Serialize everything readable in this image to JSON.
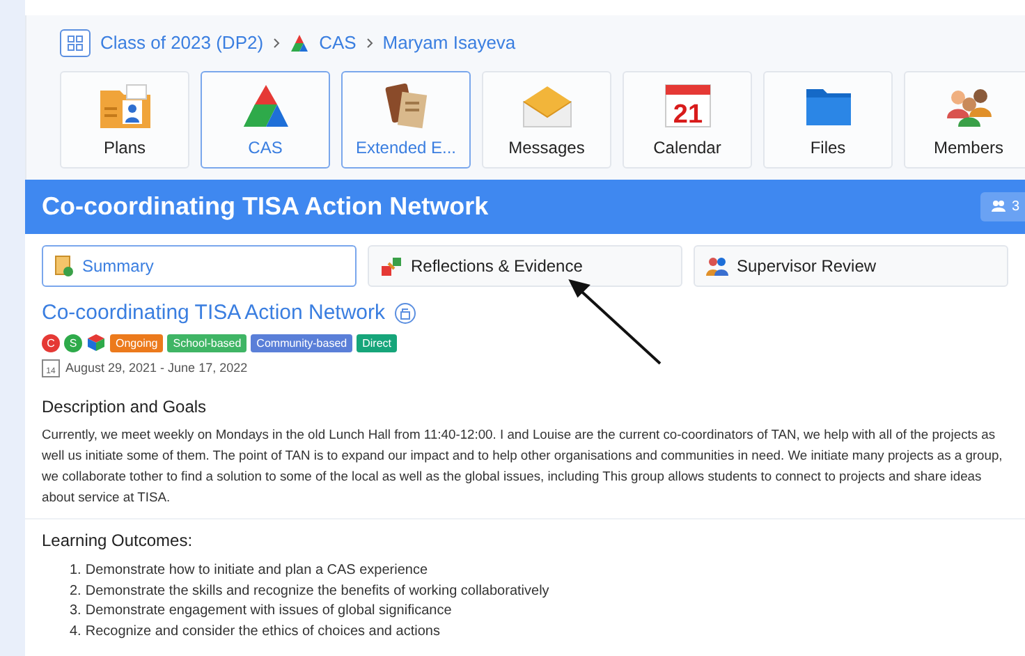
{
  "breadcrumb": [
    "Class of 2023 (DP2)",
    "CAS",
    "Maryam Isayeva"
  ],
  "tiles": [
    {
      "label": "Plans",
      "kind": "plans",
      "selected": false
    },
    {
      "label": "CAS",
      "kind": "cas",
      "selected": true
    },
    {
      "label": "Extended E...",
      "kind": "books",
      "selected": true
    },
    {
      "label": "Messages",
      "kind": "mail",
      "selected": false
    },
    {
      "label": "Calendar",
      "kind": "calendar",
      "selected": false,
      "day": "21"
    },
    {
      "label": "Files",
      "kind": "folder",
      "selected": false
    },
    {
      "label": "Members",
      "kind": "people",
      "selected": false
    }
  ],
  "header": {
    "title": "Co-coordinating TISA Action Network",
    "badge": "3"
  },
  "tabs": [
    {
      "label": "Summary",
      "kind": "summary",
      "selected": true
    },
    {
      "label": "Reflections & Evidence",
      "kind": "reflections",
      "selected": false
    },
    {
      "label": "Supervisor Review",
      "kind": "review",
      "selected": false
    }
  ],
  "activity": {
    "title": "Co-coordinating TISA Action Network",
    "strands": [
      {
        "letter": "C",
        "color": "#e53935"
      },
      {
        "letter": "S",
        "color": "#2eaa4a"
      }
    ],
    "tags": [
      {
        "label": "Ongoing",
        "color": "#ec7a1c"
      },
      {
        "label": "School-based",
        "color": "#3fb565"
      },
      {
        "label": "Community-based",
        "color": "#5a7fd8"
      },
      {
        "label": "Direct",
        "color": "#16a57a"
      }
    ],
    "calendar_day": "14",
    "dates": "August 29, 2021 - June 17, 2022"
  },
  "description": {
    "heading": "Description and Goals",
    "text": "Currently, we meet weekly on Mondays in the old Lunch Hall from 11:40-12:00. I and Louise are the current co-coordinators of TAN, we help with all of the projects as well us initiate some of them. The point of TAN is to expand our impact and to help other organisations and communities in need. We initiate many projects as a group, we collaborate tother to find a solution to some of the local as well as the global issues, including This group allows students to connect to projects and share ideas about service at TISA."
  },
  "outcomes": {
    "heading": "Learning Outcomes:",
    "items": [
      {
        "number": "1.",
        "text": "Demonstrate how to initiate and plan a CAS experience"
      },
      {
        "number": "2.",
        "text": "Demonstrate the skills and recognize the benefits of working collaboratively"
      },
      {
        "number": "3.",
        "text": "Demonstrate engagement with issues of global significance"
      },
      {
        "number": "4.",
        "text": "Recognize and consider the ethics of choices and actions"
      }
    ]
  }
}
